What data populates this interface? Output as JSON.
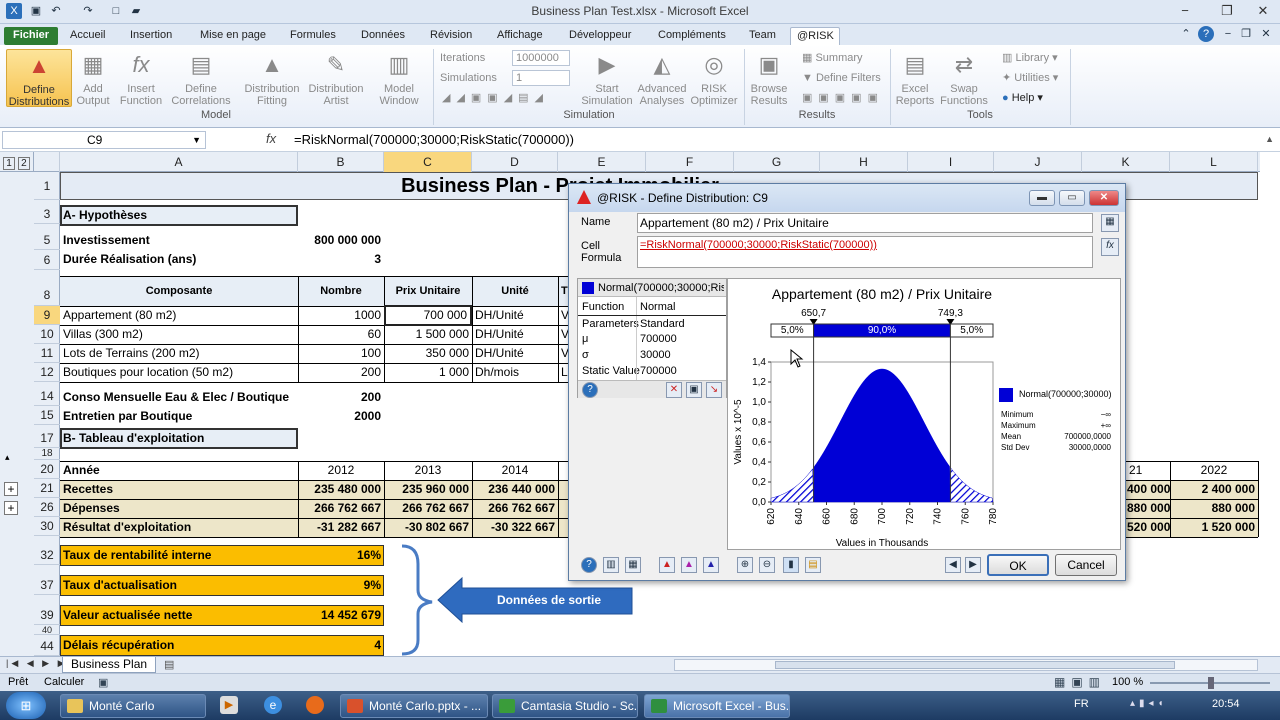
{
  "window": {
    "title": "Business Plan Test.xlsx  -  Microsoft Excel"
  },
  "tabs": [
    "Fichier",
    "Accueil",
    "Insertion",
    "Mise en page",
    "Formules",
    "Données",
    "Révision",
    "Affichage",
    "Développeur",
    "Compléments",
    "Team",
    "@RISK"
  ],
  "ribbon": {
    "define_distributions": "Define\nDistributions",
    "add_output": "Add\nOutput",
    "insert_function": "Insert\nFunction",
    "define_correlations": "Define\nCorrelations",
    "distribution_fitting": "Distribution\nFitting",
    "distribution_artist": "Distribution\nArtist",
    "model_window": "Model\nWindow",
    "group_model": "Model",
    "iterations_label": "Iterations",
    "iterations_value": "1000000",
    "simulations_label": "Simulations",
    "simulations_value": "1",
    "start_simulation": "Start\nSimulation",
    "advanced_analyses": "Advanced\nAnalyses",
    "risk_optimizer": "RISK\nOptimizer",
    "group_simulation": "Simulation",
    "browse_results": "Browse\nResults",
    "summary": "Summary",
    "define_filters": "Define Filters",
    "group_results": "Results",
    "excel_reports": "Excel\nReports",
    "swap_functions": "Swap\nFunctions",
    "library": "Library",
    "utilities": "Utilities",
    "help": "Help",
    "group_tools": "Tools"
  },
  "formula_bar": {
    "cell_ref": "C9",
    "fx": "fx",
    "formula": "=RiskNormal(700000;30000;RiskStatic(700000))"
  },
  "columns": [
    "A",
    "B",
    "C",
    "D",
    "E",
    "F",
    "G",
    "H",
    "I",
    "J",
    "K",
    "L"
  ],
  "rows": [
    "1",
    "3",
    "5",
    "6",
    "8",
    "9",
    "10",
    "11",
    "12",
    "14",
    "15",
    "17",
    "18",
    "20",
    "21",
    "26",
    "30",
    "32",
    "37",
    "39",
    "40",
    "44"
  ],
  "sheet": {
    "title": "Business Plan - Projet Immobilier",
    "hypotheses": "A- Hypothèses",
    "investissement_label": "Investissement",
    "investissement_value": "800 000 000",
    "duree_label": "Durée Réalisation (ans)",
    "duree_value": "3",
    "table_headers": [
      "Composante",
      "Nombre",
      "Prix Unitaire",
      "Unité",
      "T"
    ],
    "table_rows": [
      {
        "c": "Appartement (80 m2)",
        "n": "1000",
        "p": "700 000",
        "u": "DH/Unité",
        "t": "V"
      },
      {
        "c": "Villas (300 m2)",
        "n": "60",
        "p": "1 500 000",
        "u": "DH/Unité",
        "t": "V"
      },
      {
        "c": "Lots de Terrains (200 m2)",
        "n": "100",
        "p": "350 000",
        "u": "DH/Unité",
        "t": "V"
      },
      {
        "c": "Boutiques pour location (50 m2)",
        "n": "200",
        "p": "1 000",
        "u": "Dh/mois",
        "t": "Lo"
      }
    ],
    "conso_label": "Conso Mensuelle Eau & Elec / Boutique",
    "conso_value": "200",
    "entretien_label": "Entretien par Boutique",
    "entretien_value": "2000",
    "tableau": "B- Tableau d'exploitation",
    "annee": "Année",
    "years": [
      "2012",
      "2013",
      "2014",
      "21",
      "2022"
    ],
    "recettes": {
      "label": "Recettes",
      "vals": [
        "235 480 000",
        "235 960 000",
        "236 440 000",
        "400 000",
        "2 400 000"
      ]
    },
    "depenses": {
      "label": "Dépenses",
      "vals": [
        "266 762 667",
        "266 762 667",
        "266 762 667",
        "880 000",
        "880 000"
      ]
    },
    "resultat": {
      "label": "Résultat d'exploitation",
      "vals": [
        "-31 282 667",
        "-30 802 667",
        "-30 322 667",
        "520 000",
        "1 520 000"
      ]
    },
    "outputs": [
      {
        "label": "Taux de rentabilité interne",
        "value": "16%"
      },
      {
        "label": "Taux d'actualisation",
        "value": "9%"
      },
      {
        "label": "Valeur actualisée nette",
        "value": "14 452 679"
      },
      {
        "label": "Délais récupération",
        "value": "4"
      }
    ],
    "callout": "Données de sortie",
    "sheet_tab": "Business Plan"
  },
  "status": {
    "ready": "Prêt",
    "calc": "Calculer",
    "zoom": "100 %"
  },
  "taskbar": {
    "items": [
      "Monté Carlo",
      "Monté Carlo.pptx - ...",
      "Camtasia Studio - Sc...",
      "Microsoft Excel - Bus..."
    ],
    "lang": "FR",
    "time": "20:54"
  },
  "dialog": {
    "title": "@RISK - Define Distribution: C9",
    "name_label": "Name",
    "name_value": "Appartement (80 m2) / Prix Unitaire",
    "cell_formula_label": "Cell\nFormula",
    "formula_value": "=RiskNormal(700000;30000;RiskStatic(700000))",
    "tab_label": "Normal(700000;30000;RiskS",
    "params": [
      {
        "k": "Function",
        "v": "Normal"
      },
      {
        "k": "Parameters",
        "v": "Standard"
      },
      {
        "k": "μ",
        "v": "700000"
      },
      {
        "k": "σ",
        "v": "30000"
      },
      {
        "k": "Static Value",
        "v": "700000"
      }
    ],
    "ok": "OK",
    "cancel": "Cancel"
  },
  "chart_data": {
    "type": "area",
    "title": "Appartement (80 m2) / Prix Unitaire",
    "xlabel": "Values in Thousands",
    "ylabel": "Values x 10^-5",
    "xlim": [
      620,
      780
    ],
    "ylim": [
      0,
      1.4
    ],
    "xticks": [
      620,
      640,
      660,
      680,
      700,
      720,
      740,
      760,
      780
    ],
    "yticks": [
      "0,0",
      "0,2",
      "0,4",
      "0,6",
      "0,8",
      "1,0",
      "1,2",
      "1,4"
    ],
    "distribution": {
      "mu": 700,
      "sigma": 30
    },
    "delimiters": {
      "left": 650.7,
      "right": 749.3,
      "left_label": "650,7",
      "right_label": "749,3"
    },
    "bands": [
      "5,0%",
      "90,0%",
      "5,0%"
    ],
    "legend": {
      "series": "Normal(700000;30000)",
      "stats": [
        {
          "k": "Minimum",
          "v": "−∞"
        },
        {
          "k": "Maximum",
          "v": "+∞"
        },
        {
          "k": "Mean",
          "v": "700000,0000"
        },
        {
          "k": "Std Dev",
          "v": "30000,0000"
        }
      ]
    },
    "fill_color": "#0000d6"
  }
}
